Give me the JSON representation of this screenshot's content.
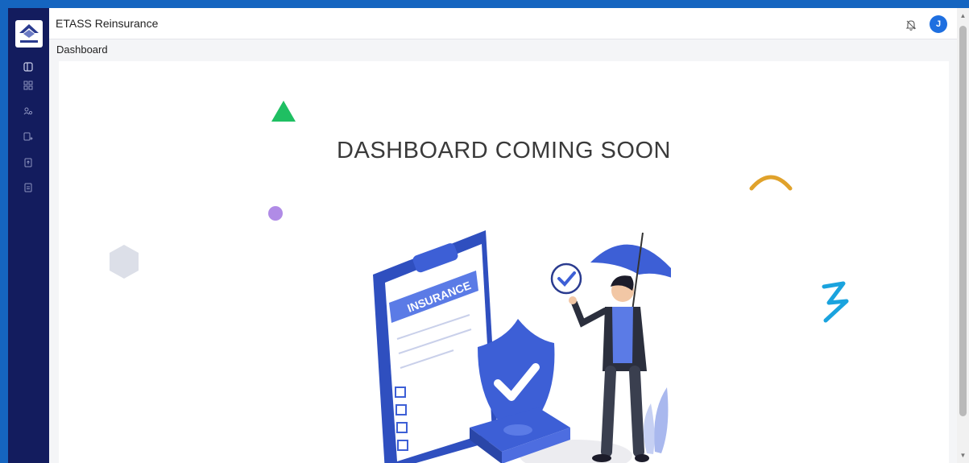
{
  "app": {
    "title": "ETASS Reinsurance",
    "avatar_initial": "J"
  },
  "breadcrumb": {
    "label": "Dashboard"
  },
  "sidebar": {
    "icons": [
      "sidebar-toggle-icon",
      "dashboard-grid-icon",
      "users-icon",
      "transfer-icon",
      "upload-file-icon",
      "document-icon"
    ]
  },
  "main": {
    "headline": "DASHBOARD COMING SOON",
    "illustration": {
      "clipboard_label": "INSURANCE"
    }
  },
  "colors": {
    "sidebar": "#131c5e",
    "accent": "#1e6fe0",
    "illustration_blue": "#3d5fd6"
  }
}
